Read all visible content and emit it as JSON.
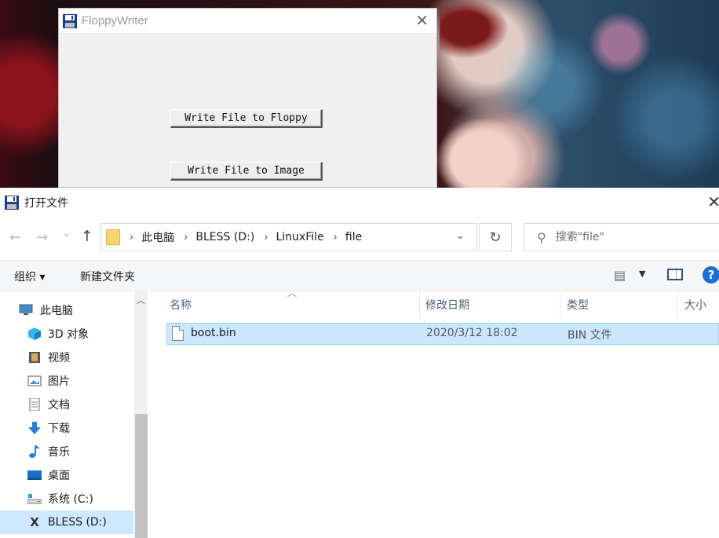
{
  "floppy_window": {
    "title": "FloppyWriter",
    "close_glyph": "✕",
    "buttons": {
      "write_to_floppy": "Write File to Floppy",
      "write_to_image": "Write File to Image"
    }
  },
  "open_dialog": {
    "title": "打开文件",
    "close_glyph": "✕",
    "nav": {
      "back": "←",
      "forward": "→",
      "recent": "⌄",
      "up": "↑"
    },
    "breadcrumbs": [
      "此电脑",
      "BLESS (D:)",
      "LinuxFile",
      "file"
    ],
    "search_placeholder": "搜索\"file\"",
    "toolbar": {
      "organize": "组织 ▾",
      "new_folder": "新建文件夹",
      "help": "?"
    },
    "nav_pane": [
      {
        "label": "此电脑",
        "icon": "computer-icon"
      },
      {
        "label": "3D 对象",
        "icon": "3d-objects-icon"
      },
      {
        "label": "视频",
        "icon": "video-icon"
      },
      {
        "label": "图片",
        "icon": "pictures-icon"
      },
      {
        "label": "文档",
        "icon": "documents-icon"
      },
      {
        "label": "下载",
        "icon": "download-icon"
      },
      {
        "label": "音乐",
        "icon": "music-icon"
      },
      {
        "label": "桌面",
        "icon": "desktop-icon"
      },
      {
        "label": "系统 (C:)",
        "icon": "drive-icon"
      },
      {
        "label": "BLESS (D:)",
        "icon": "drive-x-icon"
      }
    ],
    "columns": {
      "name": "名称",
      "modified": "修改日期",
      "type": "类型",
      "size": "大小"
    },
    "files": [
      {
        "name": "boot.bin",
        "modified": "2020/3/12 18:02",
        "type": "BIN 文件"
      }
    ],
    "selected_nav_item": "BLESS (D:)",
    "selection_color": "#cde8ff"
  }
}
